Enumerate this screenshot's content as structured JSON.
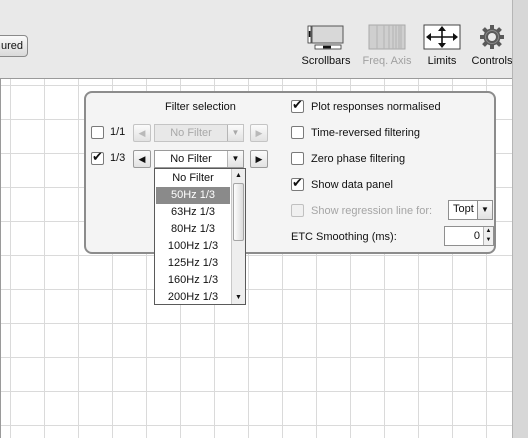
{
  "toolbar": {
    "partial_button_label": "ured",
    "scrollbars_label": "Scrollbars",
    "freq_axis_label": "Freq. Axis",
    "limits_label": "Limits",
    "controls_label": "Controls",
    "icons": {
      "scrollbars": "scrollbars-icon",
      "freq_axis": "freq-axis-icon",
      "limits": "limits-arrows-icon",
      "controls": "gear-icon"
    }
  },
  "filter": {
    "heading": "Filter selection",
    "row1": {
      "label": "1/1",
      "checked": false,
      "value": "No Filter",
      "enabled": false
    },
    "row2": {
      "label": "1/3",
      "checked": true,
      "value": "No Filter",
      "enabled": true
    },
    "dropdown_options": [
      "No Filter",
      "50Hz 1/3",
      "63Hz 1/3",
      "80Hz 1/3",
      "100Hz 1/3",
      "125Hz 1/3",
      "160Hz 1/3",
      "200Hz 1/3"
    ],
    "highlighted_option": "50Hz 1/3"
  },
  "options": {
    "plot_normalised": {
      "label": "Plot responses normalised",
      "checked": true
    },
    "time_reversed": {
      "label": "Time-reversed filtering",
      "checked": false
    },
    "zero_phase": {
      "label": "Zero phase filtering",
      "checked": false
    },
    "show_data_panel": {
      "label": "Show data panel",
      "checked": true
    },
    "regression": {
      "label": "Show regression line for:",
      "checked": false,
      "enabled": false,
      "value": "Topt"
    },
    "etc_smoothing": {
      "label": "ETC Smoothing (ms):",
      "value": "0"
    }
  },
  "colors": {
    "highlight": "#8a8a8a",
    "panel_border": "#8c8c8c",
    "disabled_text": "#a5a5a5"
  }
}
